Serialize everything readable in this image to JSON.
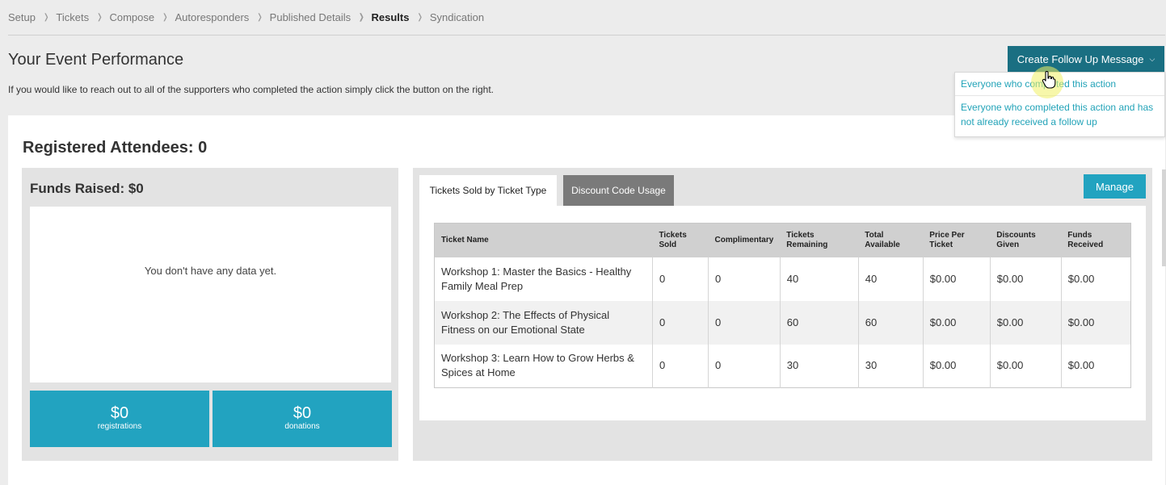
{
  "breadcrumb": {
    "items": [
      {
        "label": "Setup",
        "active": false
      },
      {
        "label": "Tickets",
        "active": false
      },
      {
        "label": "Compose",
        "active": false
      },
      {
        "label": "Autoresponders",
        "active": false
      },
      {
        "label": "Published Details",
        "active": false
      },
      {
        "label": "Results",
        "active": true
      },
      {
        "label": "Syndication",
        "active": false
      }
    ]
  },
  "header": {
    "title": "Your Event Performance",
    "description": "If you would like to reach out to all of the supporters who completed the action simply click the button on the right."
  },
  "followup": {
    "button_label": "Create Follow Up Message",
    "options": [
      "Everyone who completed this action",
      "Everyone who completed this action and has not already received a follow up"
    ]
  },
  "main": {
    "registered_attendees": "Registered Attendees: 0",
    "funds": {
      "title": "Funds Raised: $0",
      "empty_message": "You don't have any data yet.",
      "registrations_value": "$0",
      "registrations_label": "registrations",
      "donations_value": "$0",
      "donations_label": "donations"
    },
    "tickets": {
      "tabs": [
        "Tickets Sold by Ticket Type",
        "Discount Code Usage"
      ],
      "active_tab": 0,
      "manage_label": "Manage",
      "columns": [
        "Ticket Name",
        "Tickets Sold",
        "Complimentary",
        "Tickets Remaining",
        "Total Available",
        "Price Per Ticket",
        "Discounts Given",
        "Funds Received"
      ],
      "rows": [
        [
          "Workshop 1: Master the Basics - Healthy Family Meal Prep",
          "0",
          "0",
          "40",
          "40",
          "$0.00",
          "$0.00",
          "$0.00"
        ],
        [
          "Workshop 2: The Effects of Physical Fitness on our Emotional State",
          "0",
          "0",
          "60",
          "60",
          "$0.00",
          "$0.00",
          "$0.00"
        ],
        [
          "Workshop 3: Learn How to Grow Herbs & Spices at Home",
          "0",
          "0",
          "30",
          "30",
          "$0.00",
          "$0.00",
          "$0.00"
        ]
      ]
    }
  },
  "colors": {
    "teal_dark": "#1a6f82",
    "teal": "#22a3c0",
    "link": "#22a3b8"
  },
  "icons": {
    "cursor": "hand-pointer-icon",
    "dropdown": "chevron-down-icon"
  }
}
